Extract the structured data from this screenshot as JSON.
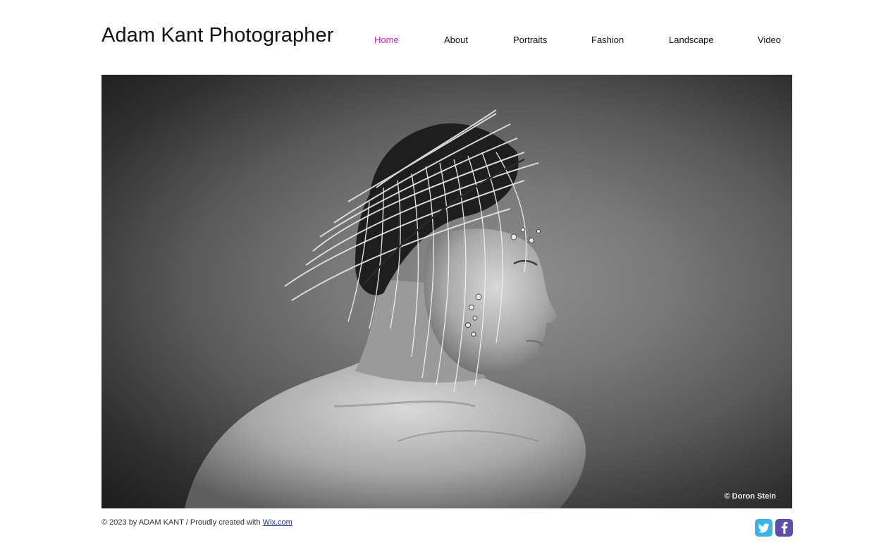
{
  "header": {
    "site_title": "Adam Kant Photographer"
  },
  "nav": {
    "items": [
      {
        "label": "Home",
        "active": true
      },
      {
        "label": "About",
        "active": false
      },
      {
        "label": "Portraits",
        "active": false
      },
      {
        "label": "Fashion",
        "active": false
      },
      {
        "label": "Landscape",
        "active": false
      },
      {
        "label": "Video",
        "active": false
      }
    ],
    "active_color": "#d21fc8"
  },
  "hero": {
    "credit": "© Doron Stein"
  },
  "footer": {
    "copyright": "© 2023 by ADAM KANT / Proudly created with ",
    "link_label": "Wix.com"
  },
  "social": {
    "twitter_icon": "twitter-icon",
    "facebook_icon": "facebook-icon",
    "twitter_color": "#39b3e8",
    "facebook_color": "#5d4fa8"
  }
}
